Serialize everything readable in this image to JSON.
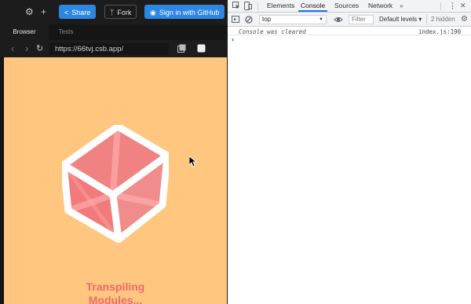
{
  "toolbar": {
    "share_label": "Share",
    "fork_label": "Fork",
    "signin_label": "Sign in with GitHub"
  },
  "tabs": [
    {
      "label": "Browser",
      "active": true
    },
    {
      "label": "Tests",
      "active": false
    }
  ],
  "browser": {
    "url": "https://66tvj.csb.app/"
  },
  "preview": {
    "loading_text_line1": "Transpiling",
    "loading_text_line2": "Modules..."
  },
  "devtools": {
    "tabs": [
      {
        "label": "Elements",
        "active": false
      },
      {
        "label": "Console",
        "active": true
      },
      {
        "label": "Sources",
        "active": false
      },
      {
        "label": "Network",
        "active": false
      }
    ],
    "more_tabs_label": "»",
    "context": "top",
    "filter_placeholder": "Filter",
    "levels_label": "Default levels ▾",
    "hidden_label": "2 hidden",
    "console_message": "Console was cleared",
    "console_source": "index.js:190",
    "prompt_symbol": "›"
  },
  "colors": {
    "accent_blue": "#2d87e2",
    "preview_background": "#ffc67f",
    "loading_text": "#ef6a6a",
    "devtools_active_tab": "#1a73e8"
  }
}
